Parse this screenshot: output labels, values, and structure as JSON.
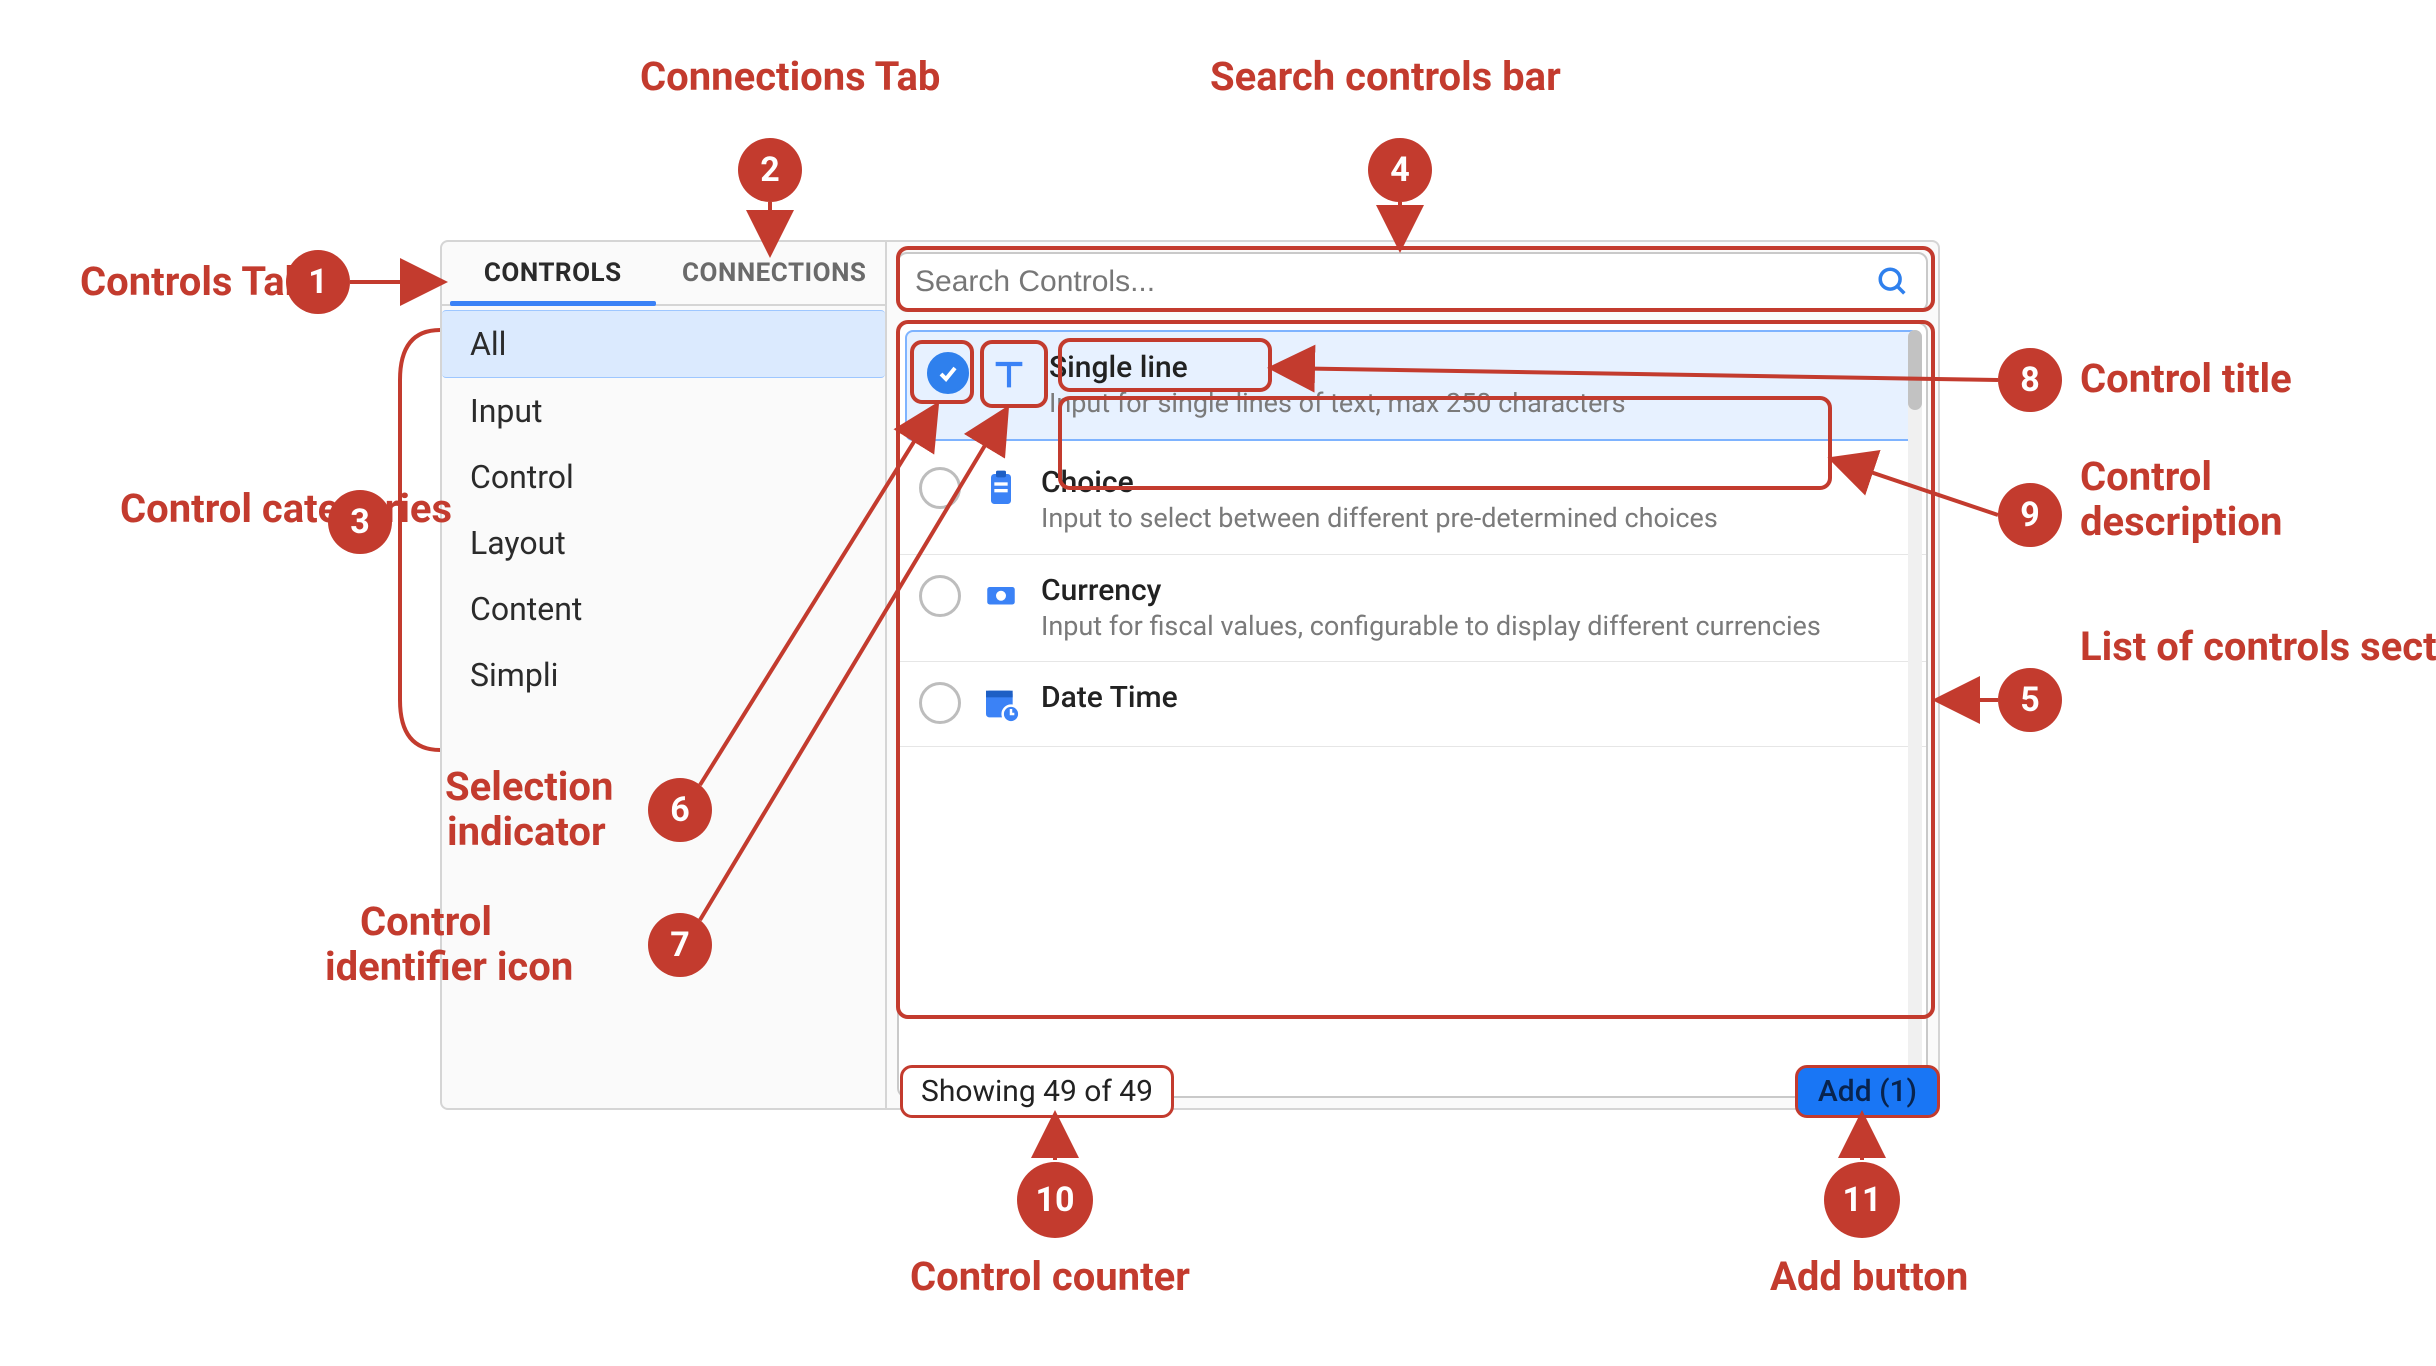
{
  "tabs": {
    "controls": "CONTROLS",
    "connections": "CONNECTIONS"
  },
  "categories": [
    "All",
    "Input",
    "Control",
    "Layout",
    "Content",
    "Simpli"
  ],
  "active_category_index": 0,
  "search": {
    "placeholder": "Search Controls..."
  },
  "controls": [
    {
      "title": "Single line",
      "desc": "Input for single lines of text, max 250 characters",
      "icon": "text-icon",
      "selected": true
    },
    {
      "title": "Choice",
      "desc": "Input to select between different pre-determined choices",
      "icon": "clipboard-icon",
      "selected": false
    },
    {
      "title": "Currency",
      "desc": "Input for fiscal values, configurable to display different currencies",
      "icon": "currency-icon",
      "selected": false
    },
    {
      "title": "Date Time",
      "desc": "",
      "icon": "calendar-icon",
      "selected": false
    }
  ],
  "footer": {
    "counter": "Showing 49 of 49",
    "add_label": "Add (1)"
  },
  "annotations": {
    "1": "Controls Tab",
    "2": "Connections Tab",
    "3": "Control categories",
    "4": "Search controls bar",
    "5": "List of controls section",
    "6": "Selection indicator",
    "7": "Control identifier icon",
    "8": "Control title",
    "9": "Control description",
    "10": "Control counter",
    "11": "Add button"
  }
}
